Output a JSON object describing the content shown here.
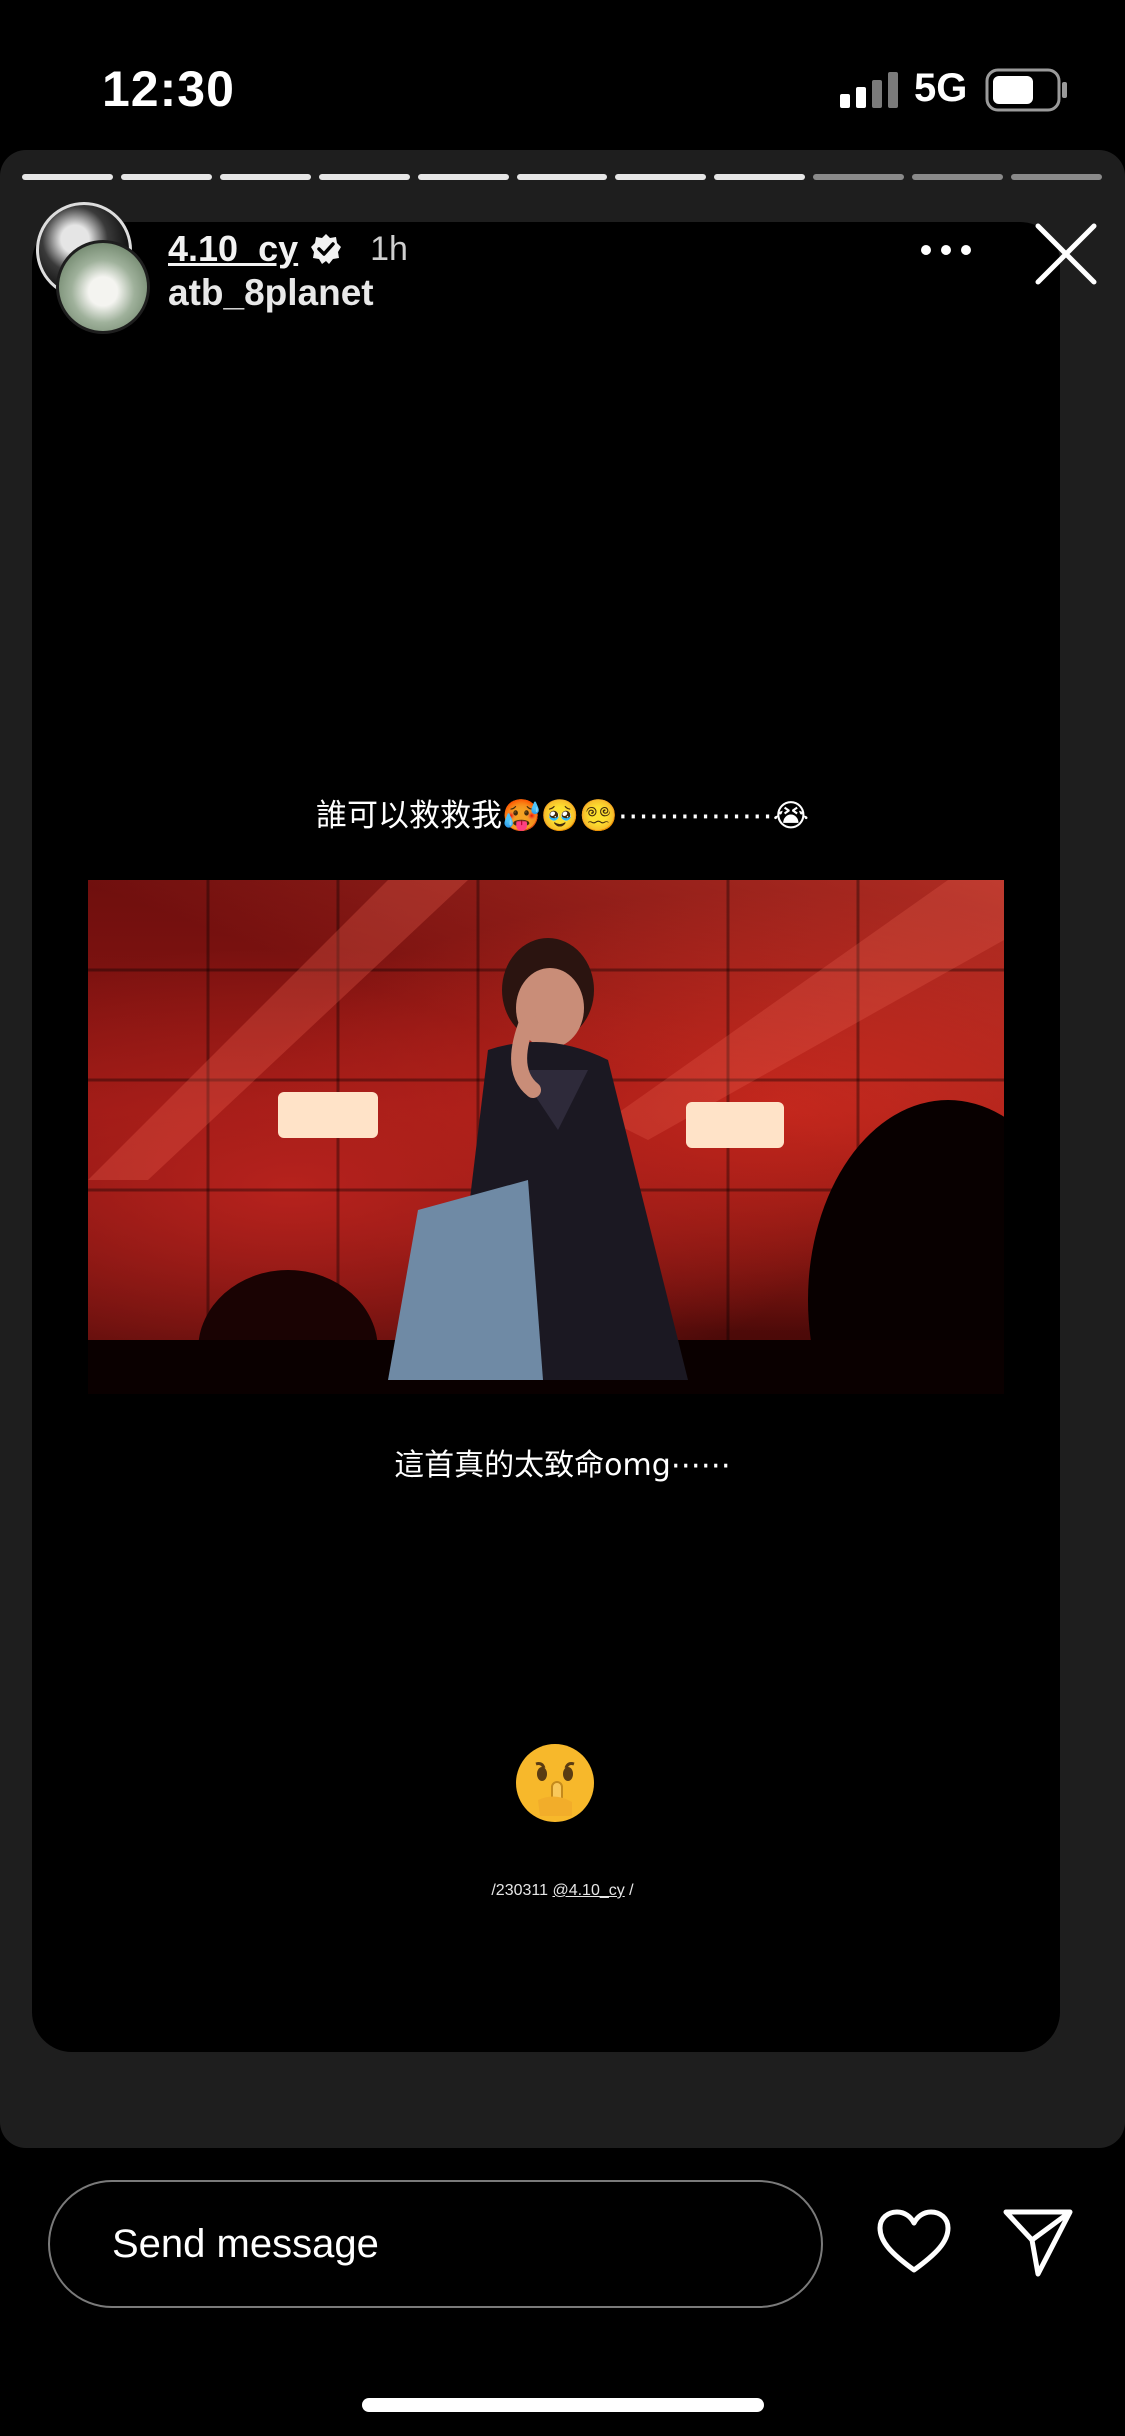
{
  "status_bar": {
    "time": "12:30",
    "network": "5G",
    "icons": [
      "signal-icon",
      "battery-icon"
    ]
  },
  "story": {
    "segments_total": 11,
    "segments_seen": 8,
    "author": "4.10_cy",
    "author_verified": true,
    "time_ago": "1h",
    "collaborator": "atb_8planet",
    "caption_top": "誰可以救救我🥵🥹😵‍💫⋯⋯⋯⋯⋯😭",
    "caption_bottom": "這首真的太致命omg⋯⋯",
    "emoji_sticker": "🤫",
    "credit_prefix": "/230311 ",
    "credit_handle": "@4.10_cy",
    "credit_suffix": " /",
    "photo_description_icon": "concert-photo"
  },
  "reply": {
    "placeholder": "Send message"
  },
  "colors": {
    "background": "#000000",
    "panel": "#1e1e1e",
    "progress_seen": "#e6e6e6",
    "progress_unseen": "#8a8a8a"
  }
}
